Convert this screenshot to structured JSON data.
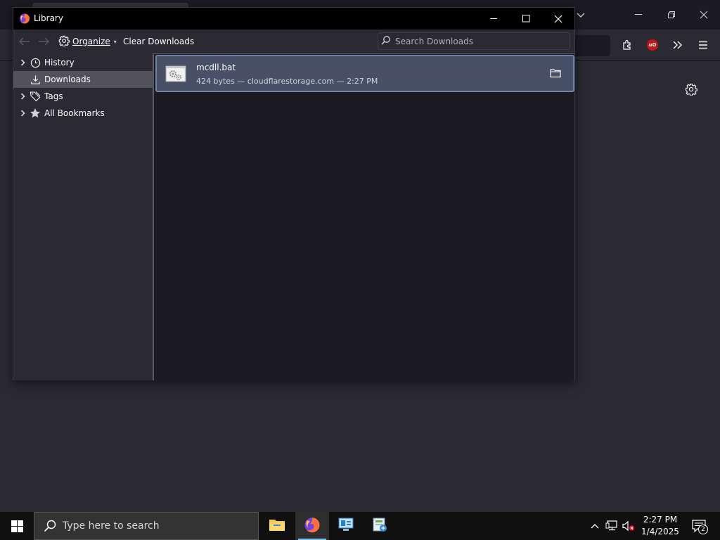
{
  "library_window": {
    "title": "Library",
    "toolbar": {
      "organize_label": "Organize",
      "clear_downloads_label": "Clear Downloads",
      "search_placeholder": "Search Downloads"
    },
    "sidebar": {
      "items": [
        {
          "label": "History",
          "icon": "clock-icon",
          "expandable": true,
          "selected": false
        },
        {
          "label": "Downloads",
          "icon": "download-icon",
          "expandable": false,
          "selected": true
        },
        {
          "label": "Tags",
          "icon": "tag-icon",
          "expandable": true,
          "selected": false
        },
        {
          "label": "All Bookmarks",
          "icon": "star-icon",
          "expandable": true,
          "selected": false
        }
      ]
    },
    "downloads": [
      {
        "filename": "mcdll.bat",
        "status": "424 bytes — cloudflarestorage.com — 2:27 PM",
        "icon": "batch-file-icon"
      }
    ]
  },
  "taskbar": {
    "search_placeholder": "Type here to search",
    "apps": [
      {
        "name": "file-explorer-icon",
        "active": false
      },
      {
        "name": "firefox-icon",
        "active": true
      },
      {
        "name": "control-panel-icon",
        "active": false
      },
      {
        "name": "network-setup-icon",
        "active": false
      }
    ],
    "clock": {
      "time": "2:27 PM",
      "date": "1/4/2025"
    },
    "notification_count": "2"
  },
  "colors": {
    "library_bg": "#1c1b22",
    "toolbar_bg": "#2b2a33",
    "selected_row": "#475066",
    "selected_row_border": "#6d84a8",
    "taskbar_bg": "#101010"
  }
}
